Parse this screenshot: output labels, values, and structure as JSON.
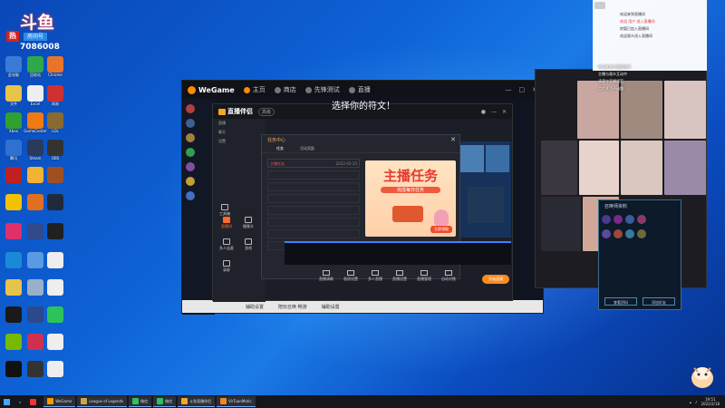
{
  "overlay": {
    "name": "斗鱼",
    "hot_badge": "热",
    "room_label": "房间号",
    "viewer_count": "7086008"
  },
  "desktop_icons": [
    {
      "label": "此电脑",
      "color": "#3a7bd5"
    },
    {
      "label": "回收站",
      "color": "#7a8aa0"
    },
    {
      "label": "Chrome",
      "color": "#e84a3b"
    },
    {
      "label": "文件",
      "color": "#e8c34a"
    },
    {
      "label": "Excel",
      "color": "#1f8a4a"
    },
    {
      "label": "网易",
      "color": "#d03030"
    },
    {
      "label": "Xbox",
      "color": "#30a030"
    },
    {
      "label": "GameCenter",
      "color": "#f07a10"
    },
    {
      "label": "LOL",
      "color": "#8a6a30"
    },
    {
      "label": "腾讯",
      "color": "#3070d0"
    },
    {
      "label": "Steam",
      "color": "#2a3a5a"
    },
    {
      "label": "OBS",
      "color": "#333"
    }
  ],
  "wegame": {
    "logo": "WeGame",
    "tabs": [
      "主页",
      "商店",
      "先锋测试",
      "直播"
    ],
    "bottom_items": [
      "辅助设置",
      "陪玩召唤 畅游",
      "辅助设置"
    ]
  },
  "studio": {
    "brand": "直播伴侣",
    "pill": "高级",
    "title": "选择你的符文！",
    "side_rows": [
      "直播",
      "聊天",
      "设置"
    ],
    "tools": [
      {
        "label": "工具箱",
        "hot": false
      },
      {
        "label": "直播间",
        "hot": true
      },
      {
        "label": "摄像头",
        "hot": false
      },
      {
        "label": "多人连麦",
        "hot": false
      },
      {
        "label": "游戏",
        "hot": false
      },
      {
        "label": "录屏",
        "hot": false
      }
    ],
    "toolbar": [
      "直播清晰",
      "画质设置",
      "多人直播",
      "直播设置",
      "直播管理",
      "自动对焦"
    ],
    "start_button": "开始直播"
  },
  "dialog": {
    "header": "任务中心",
    "tabs": [
      "任务",
      "活动奖励"
    ],
    "task_row": {
      "name": "主播任务",
      "date": "2022-02-15"
    },
    "banner": {
      "title": "主播任务",
      "subtitle": "完成每日任务",
      "cta": "立即领取"
    }
  },
  "chat": {
    "lines": [
      "欢迎来到直播间",
      "欢迎 用户 进入直播间",
      "房管已加入直播间",
      "欢迎观众进入直播间"
    ]
  },
  "left_chat": {
    "lines": [
      "欢迎来到主播直播间",
      "主播与观众互动中",
      "请遵守直播规范",
      "点个关注不迷路"
    ]
  },
  "hero_panel": {
    "title": "召唤师资料",
    "buttons": [
      "查看资料",
      "添加好友"
    ]
  },
  "taskbar": {
    "items": [
      {
        "label": "",
        "color": "#e33",
        "active": false
      },
      {
        "label": "WeGame",
        "color": "#f90",
        "active": true
      },
      {
        "label": "League of Legends",
        "color": "#c9a84a",
        "active": true
      },
      {
        "label": "微信",
        "color": "#2ec35a",
        "active": true
      },
      {
        "label": "微信",
        "color": "#2ec35a",
        "active": true
      },
      {
        "label": "斗鱼直播伴侣",
        "color": "#f5a623",
        "active": true
      },
      {
        "label": "VirTuanMotic",
        "color": "#f58623",
        "active": true
      }
    ],
    "time": "19:51",
    "date": "2022/2/18"
  }
}
